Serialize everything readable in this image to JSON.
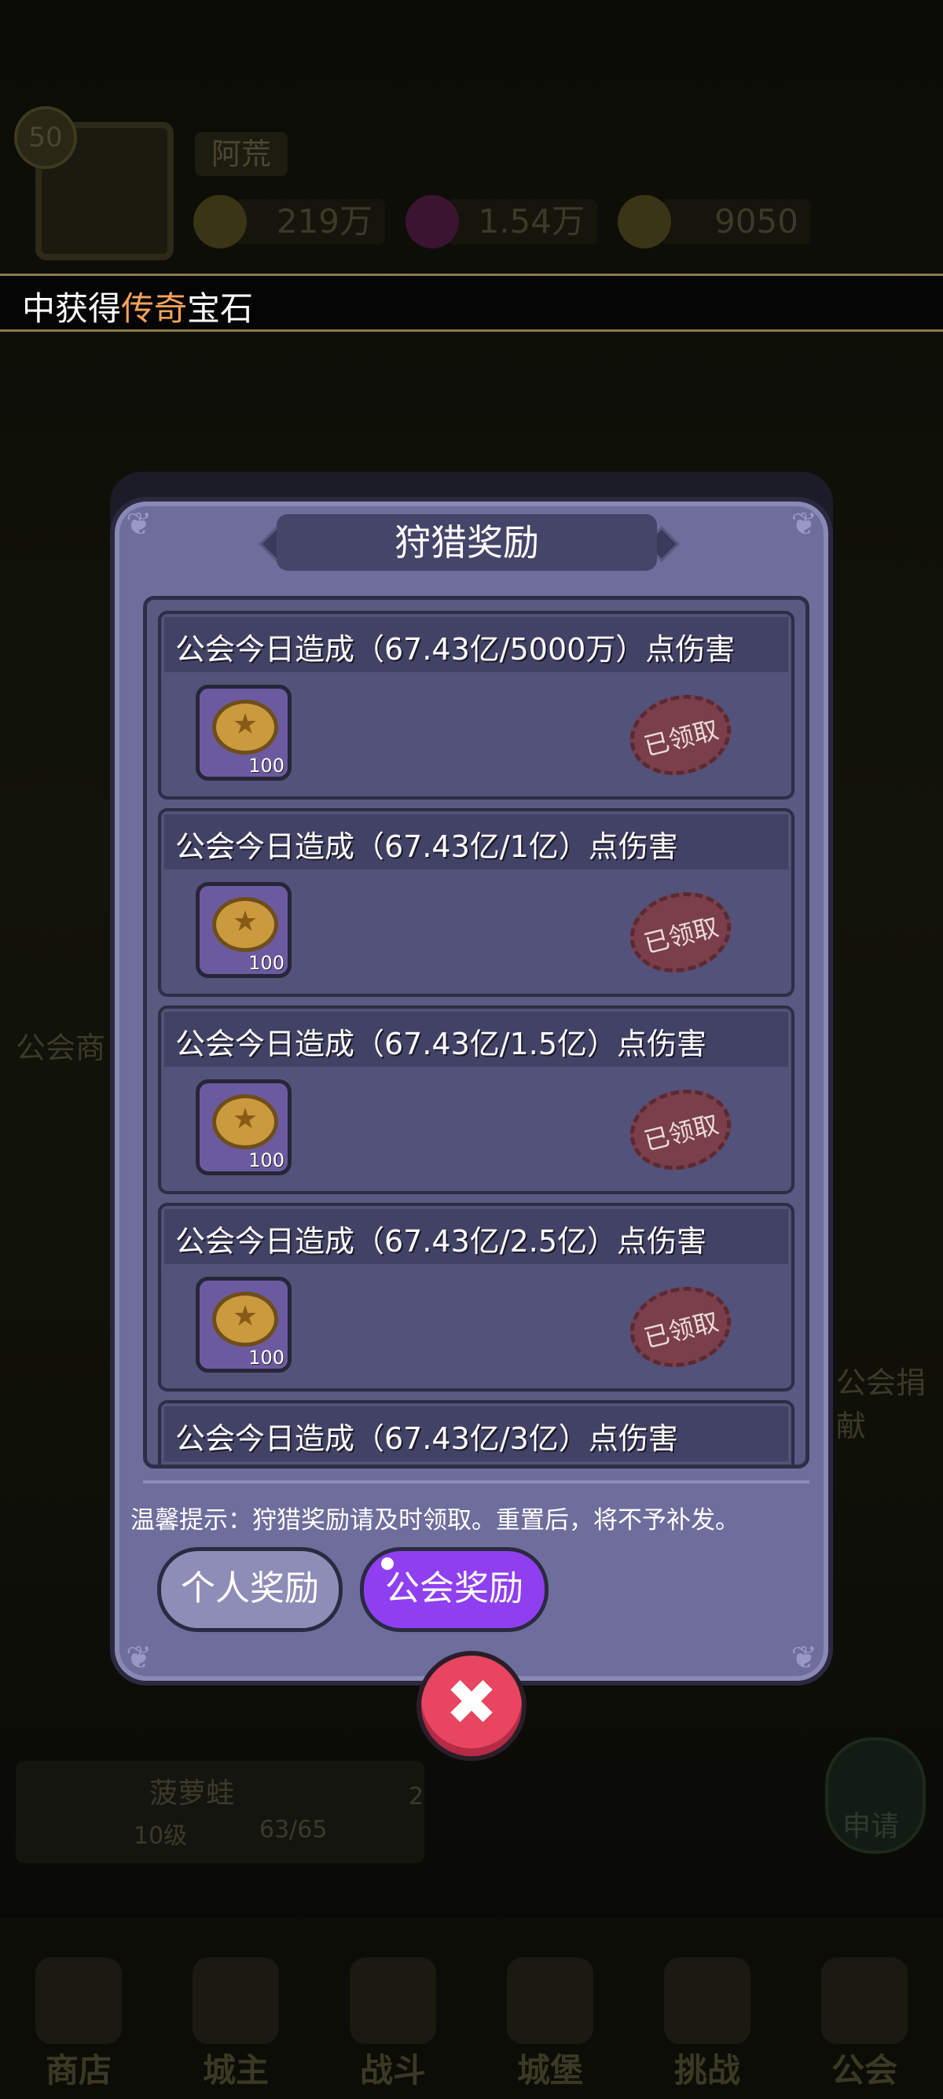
{
  "header": {
    "level": "50",
    "player_name": "阿荒",
    "resources": [
      "219万",
      "1.54万",
      "9050"
    ]
  },
  "ticker": {
    "prefix": "中获得",
    "highlight": "传奇",
    "suffix": "宝石"
  },
  "background": {
    "guild_shop": "公会商",
    "guild_donate": "公会捐献",
    "guild_name": "菠萝蛙",
    "guild_level": "10级",
    "guild_members": "63/65",
    "apply": "申请",
    "badge": "2"
  },
  "bottom_nav": [
    "商店",
    "城主",
    "战斗",
    "城堡",
    "挑战",
    "公会"
  ],
  "modal": {
    "title": "狩猎奖励",
    "items": [
      {
        "label": "公会今日造成（67.43亿/5000万）点伤害",
        "count": "100",
        "status": "已领取"
      },
      {
        "label": "公会今日造成（67.43亿/1亿）点伤害",
        "count": "100",
        "status": "已领取"
      },
      {
        "label": "公会今日造成（67.43亿/1.5亿）点伤害",
        "count": "100",
        "status": "已领取"
      },
      {
        "label": "公会今日造成（67.43亿/2.5亿）点伤害",
        "count": "100",
        "status": "已领取"
      },
      {
        "label": "公会今日造成（67.43亿/3亿）点伤害"
      }
    ],
    "hint": "温馨提示：狩猎奖励请及时领取。重置后，将不予补发。",
    "tabs": {
      "personal": "个人奖励",
      "guild": "公会奖励"
    },
    "close_icon": "✖"
  },
  "colors": {
    "modal_bg": "#6e6d9c",
    "tab_active": "#8f3ff0",
    "close": "#e84560",
    "highlight": "#f3a35a"
  }
}
